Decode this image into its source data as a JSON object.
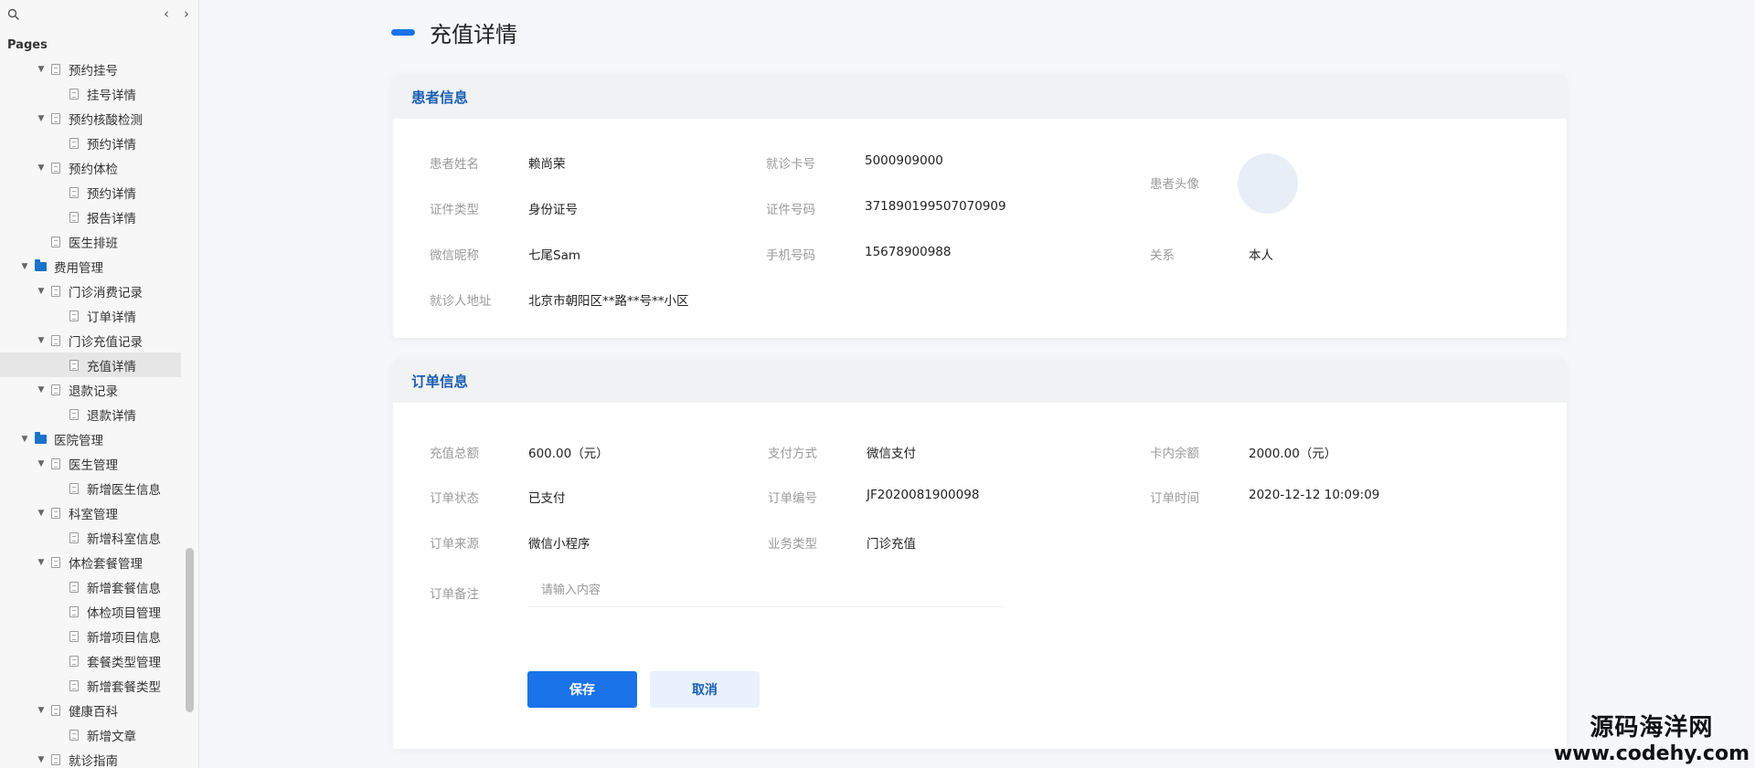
{
  "sidebar": {
    "pages_label": "Pages",
    "items": [
      {
        "label": "预约挂号",
        "level": 1,
        "type": "page",
        "expanded": true
      },
      {
        "label": "挂号详情",
        "level": 2,
        "type": "page"
      },
      {
        "label": "预约核酸检测",
        "level": 1,
        "type": "page",
        "expanded": true
      },
      {
        "label": "预约详情",
        "level": 2,
        "type": "page"
      },
      {
        "label": "预约体检",
        "level": 1,
        "type": "page",
        "expanded": true
      },
      {
        "label": "预约详情",
        "level": 2,
        "type": "page"
      },
      {
        "label": "报告详情",
        "level": 2,
        "type": "page"
      },
      {
        "label": "医生排班",
        "level": 1,
        "type": "page",
        "noCaret": true
      },
      {
        "label": "费用管理",
        "level": 0,
        "type": "folder",
        "expanded": true
      },
      {
        "label": "门诊消费记录",
        "level": 1,
        "type": "page",
        "expanded": true
      },
      {
        "label": "订单详情",
        "level": 2,
        "type": "page"
      },
      {
        "label": "门诊充值记录",
        "level": 1,
        "type": "page",
        "expanded": true
      },
      {
        "label": "充值详情",
        "level": 2,
        "type": "page",
        "selected": true
      },
      {
        "label": "退款记录",
        "level": 1,
        "type": "page",
        "expanded": true
      },
      {
        "label": "退款详情",
        "level": 2,
        "type": "page"
      },
      {
        "label": "医院管理",
        "level": 0,
        "type": "folder",
        "expanded": true
      },
      {
        "label": "医生管理",
        "level": 1,
        "type": "page",
        "expanded": true
      },
      {
        "label": "新增医生信息",
        "level": 2,
        "type": "page"
      },
      {
        "label": "科室管理",
        "level": 1,
        "type": "page",
        "expanded": true
      },
      {
        "label": "新增科室信息",
        "level": 2,
        "type": "page"
      },
      {
        "label": "体检套餐管理",
        "level": 1,
        "type": "page",
        "expanded": true
      },
      {
        "label": "新增套餐信息",
        "level": 2,
        "type": "page"
      },
      {
        "label": "体检项目管理",
        "level": 2,
        "type": "page"
      },
      {
        "label": "新增项目信息",
        "level": 2,
        "type": "page"
      },
      {
        "label": "套餐类型管理",
        "level": 2,
        "type": "page"
      },
      {
        "label": "新增套餐类型",
        "level": 2,
        "type": "page"
      },
      {
        "label": "健康百科",
        "level": 1,
        "type": "page",
        "expanded": true
      },
      {
        "label": "新增文章",
        "level": 2,
        "type": "page"
      },
      {
        "label": "就诊指南",
        "level": 1,
        "type": "page",
        "expanded": true
      }
    ]
  },
  "page": {
    "title": "充值详情"
  },
  "patient": {
    "section_title": "患者信息",
    "name_label": "患者姓名",
    "name": "赖尚荣",
    "card_label": "就诊卡号",
    "card": "5000909000",
    "avatar_label": "患者头像",
    "idtype_label": "证件类型",
    "idtype": "身份证号",
    "idno_label": "证件号码",
    "idno": "371890199507070909",
    "wechat_label": "微信昵称",
    "wechat": "七尾Sam",
    "phone_label": "手机号码",
    "phone": "15678900988",
    "relation_label": "关系",
    "relation": "本人",
    "address_label": "就诊人地址",
    "address": "北京市朝阳区**路**号**小区"
  },
  "order": {
    "section_title": "订单信息",
    "amount_label": "充值总额",
    "amount": "600.00（元）",
    "paymethod_label": "支付方式",
    "paymethod": "微信支付",
    "balance_label": "卡内余额",
    "balance": "2000.00（元）",
    "status_label": "订单状态",
    "status": "已支付",
    "number_label": "订单编号",
    "number": "JF2020081900098",
    "time_label": "订单时间",
    "time": "2020-12-12 10:09:09",
    "source_label": "订单来源",
    "source": "微信小程序",
    "biztype_label": "业务类型",
    "biztype": "门诊充值",
    "remark_label": "订单备注",
    "remark_placeholder": "请输入内容",
    "save_label": "保存",
    "cancel_label": "取消"
  },
  "watermark": {
    "cn": "源码海洋网",
    "en": "www.codehy.com"
  },
  "colors": {
    "accent": "#1a73e8",
    "section_title": "#1a5fb4",
    "folder": "#1a73c8"
  }
}
